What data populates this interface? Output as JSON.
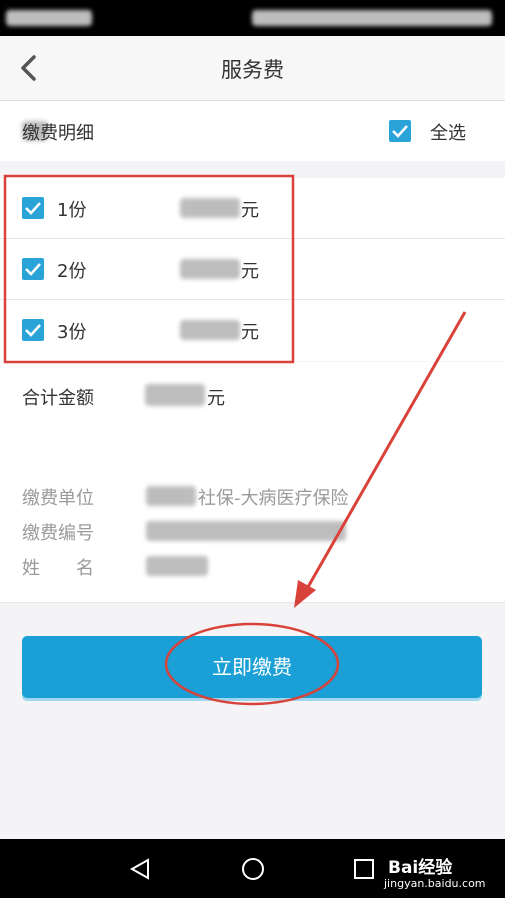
{
  "header": {
    "title": "服务费"
  },
  "detail": {
    "label": "缴费明细",
    "select_all": "全选"
  },
  "items": [
    {
      "qty": "1份",
      "amount_suffix": "元"
    },
    {
      "qty": "2份",
      "amount_suffix": "元"
    },
    {
      "qty": "3份",
      "amount_suffix": "元"
    }
  ],
  "total": {
    "label": "合计金额",
    "amount_suffix": "元"
  },
  "info": {
    "unit_label": "缴费单位",
    "unit_value": "社保-大病医疗保险",
    "code_label": "缴费编号",
    "name_label": "姓　　名"
  },
  "pay_button": "立即缴费",
  "watermark": {
    "brand": "Bai经验",
    "url": "jingyan.baidu.com"
  },
  "colors": {
    "accent": "#1aa0d6",
    "annotation": "#d9423a"
  }
}
